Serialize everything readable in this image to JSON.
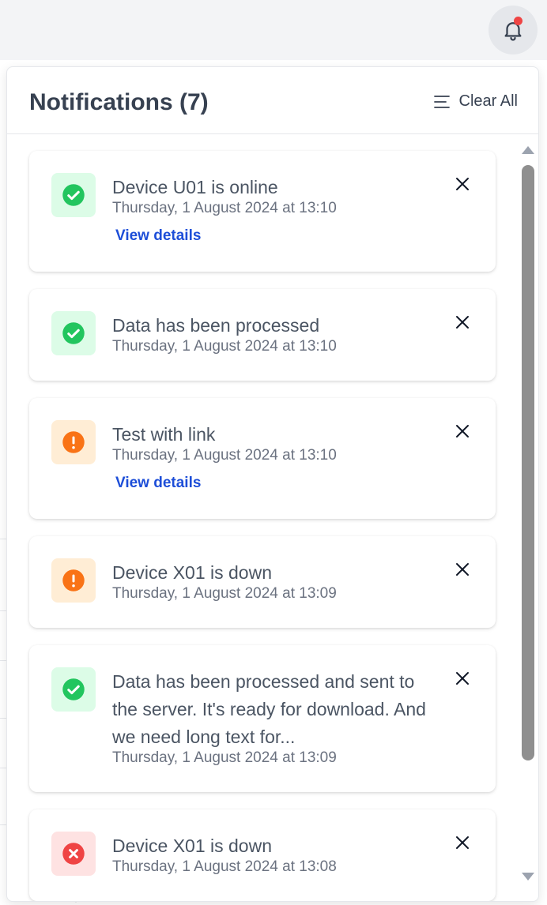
{
  "header": {
    "title": "Notifications (7)",
    "clear_all_label": "Clear All",
    "bell_icon": "bell-icon",
    "badge_color": "#ef4444"
  },
  "colors": {
    "success": "#22c55e",
    "warning": "#f97316",
    "error": "#ef4444",
    "link": "#1d4ed8"
  },
  "notifications": [
    {
      "type": "success",
      "icon": "check-circle-icon",
      "message": "Device U01 is online",
      "timestamp": "Thursday, 1 August 2024 at 13:10",
      "link_label": "View details"
    },
    {
      "type": "success",
      "icon": "check-circle-icon",
      "message": "Data has been processed",
      "timestamp": "Thursday, 1 August 2024 at 13:10"
    },
    {
      "type": "warning",
      "icon": "exclamation-circle-icon",
      "message": "Test with link",
      "timestamp": "Thursday, 1 August 2024 at 13:10",
      "link_label": "View details"
    },
    {
      "type": "warning",
      "icon": "exclamation-circle-icon",
      "message": "Device X01 is down",
      "timestamp": "Thursday, 1 August 2024 at 13:09"
    },
    {
      "type": "success",
      "icon": "check-circle-icon",
      "message": "Data has been processed and sent to the server. It's ready for download. And we need long text for...",
      "timestamp": "Thursday, 1 August 2024 at 13:09"
    },
    {
      "type": "error",
      "icon": "x-circle-icon",
      "message": "Device X01 is down",
      "timestamp": "Thursday, 1 August 2024 at 13:08"
    }
  ]
}
